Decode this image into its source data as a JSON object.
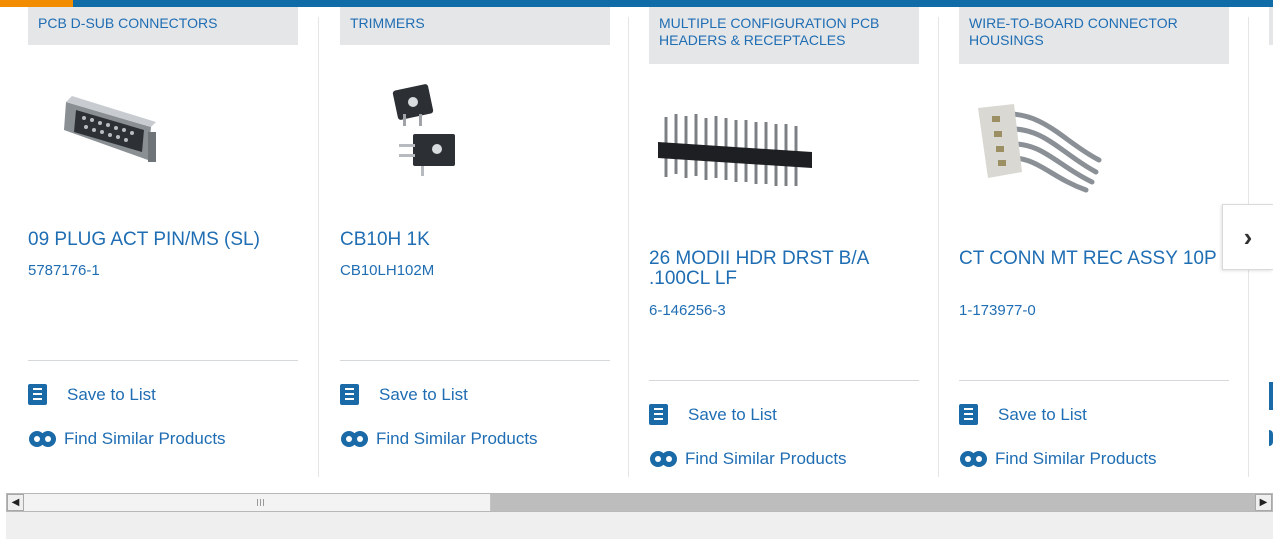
{
  "colors": {
    "accent": "#f28c00",
    "brand": "#0f6ca6",
    "link": "#1f6db3",
    "category_bg": "#e4e6e8"
  },
  "cards": [
    {
      "category": "PCB D-SUB CONNECTORS",
      "title": "09 PLUG ACT PIN/MS (SL)",
      "part_number": "5787176-1",
      "save_label": "Save to List",
      "similar_label": "Find Similar Products"
    },
    {
      "category": "TRIMMERS",
      "title": "CB10H 1K",
      "part_number": "CB10LH102M",
      "save_label": "Save to List",
      "similar_label": "Find Similar Products"
    },
    {
      "category": "MULTIPLE CONFIGURATION PCB HEADERS & RECEPTACLES",
      "title": "26 MODII HDR DRST B/A .100CL LF",
      "part_number": "6-146256-3",
      "save_label": "Save to List",
      "similar_label": "Find Similar Products"
    },
    {
      "category": "WIRE-TO-BOARD CONNECTOR HOUSINGS",
      "title": "CT CONN MT REC ASSY 10P",
      "part_number": "1-173977-0",
      "save_label": "Save to List",
      "similar_label": "Find Similar Products"
    }
  ],
  "carousel": {
    "next_icon": "chevron-right-icon",
    "next_glyph": "›"
  },
  "scrollbar": {
    "left_glyph": "◀",
    "right_glyph": "▶"
  }
}
